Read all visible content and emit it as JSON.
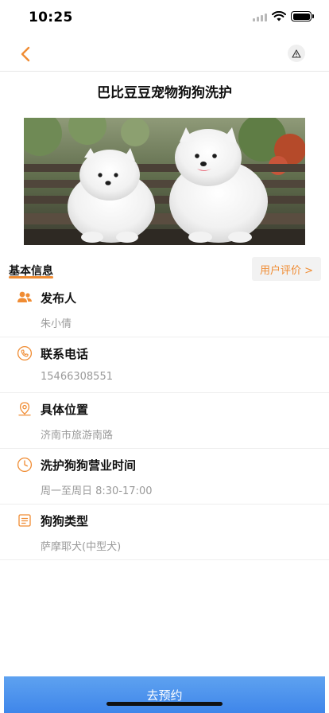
{
  "status_bar": {
    "time": "10:25"
  },
  "page": {
    "title": "巴比豆豆宠物狗狗洗护"
  },
  "section": {
    "title": "基本信息",
    "review_button": "用户评价 >"
  },
  "info": [
    {
      "icon": "people-icon",
      "label": "发布人",
      "value": "朱小倩"
    },
    {
      "icon": "phone-icon",
      "label": "联系电话",
      "value": "15466308551"
    },
    {
      "icon": "location-pin-icon",
      "label": "具体位置",
      "value": "济南市旅游南路"
    },
    {
      "icon": "clock-icon",
      "label": "洗护狗狗营业时间",
      "value": "周一至周日 8:30-17:00"
    },
    {
      "icon": "list-icon",
      "label": "狗狗类型",
      "value": "萨摩耶犬(中型犬)"
    }
  ],
  "bottom": {
    "book_button": "去预约"
  },
  "colors": {
    "accent": "#f08c33",
    "button_blue": "#4a8ff0"
  }
}
